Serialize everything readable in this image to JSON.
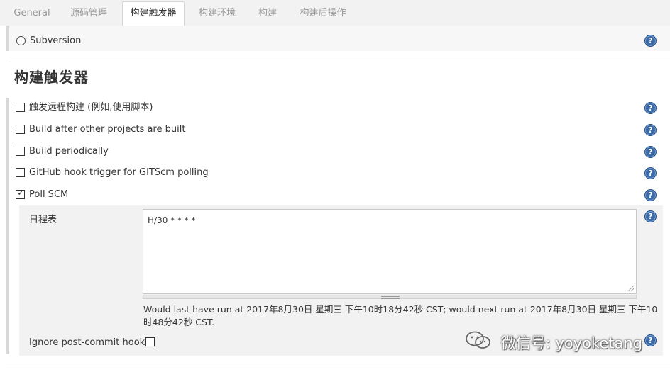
{
  "tabs": [
    {
      "label": "General"
    },
    {
      "label": "源码管理"
    },
    {
      "label": "构建触发器"
    },
    {
      "label": "构建环境"
    },
    {
      "label": "构建"
    },
    {
      "label": "构建后操作"
    }
  ],
  "active_tab": "构建触发器",
  "scm": {
    "subversion_label": "Subversion",
    "subversion_selected": false
  },
  "section": {
    "title": "构建触发器"
  },
  "triggers": [
    {
      "label": "触发远程构建 (例如,使用脚本)",
      "checked": false
    },
    {
      "label": "Build after other projects are built",
      "checked": false
    },
    {
      "label": "Build periodically",
      "checked": false
    },
    {
      "label": "GitHub hook trigger for GITScm polling",
      "checked": false
    },
    {
      "label": "Poll SCM",
      "checked": true
    }
  ],
  "poll_scm": {
    "schedule_label": "日程表",
    "schedule_value": "H/30 * * * *",
    "status_line1": "Would last have run at 2017年8月30日 星期三 下午10时18分42秒 CST; would next run at 2017年8月30日 星期三 下午10",
    "status_line2": "时48分42秒 CST.",
    "ignore_label": "Ignore post-commit hooks",
    "ignore_checked": false
  },
  "help_icon": "?",
  "watermark": {
    "text": "微信号: yoyoketang",
    "icon": "wechat-icon"
  },
  "colors": {
    "help_blue": "#3a6aa8",
    "tab_bar": "#f2f2f2",
    "panel": "#f2f2f2"
  }
}
